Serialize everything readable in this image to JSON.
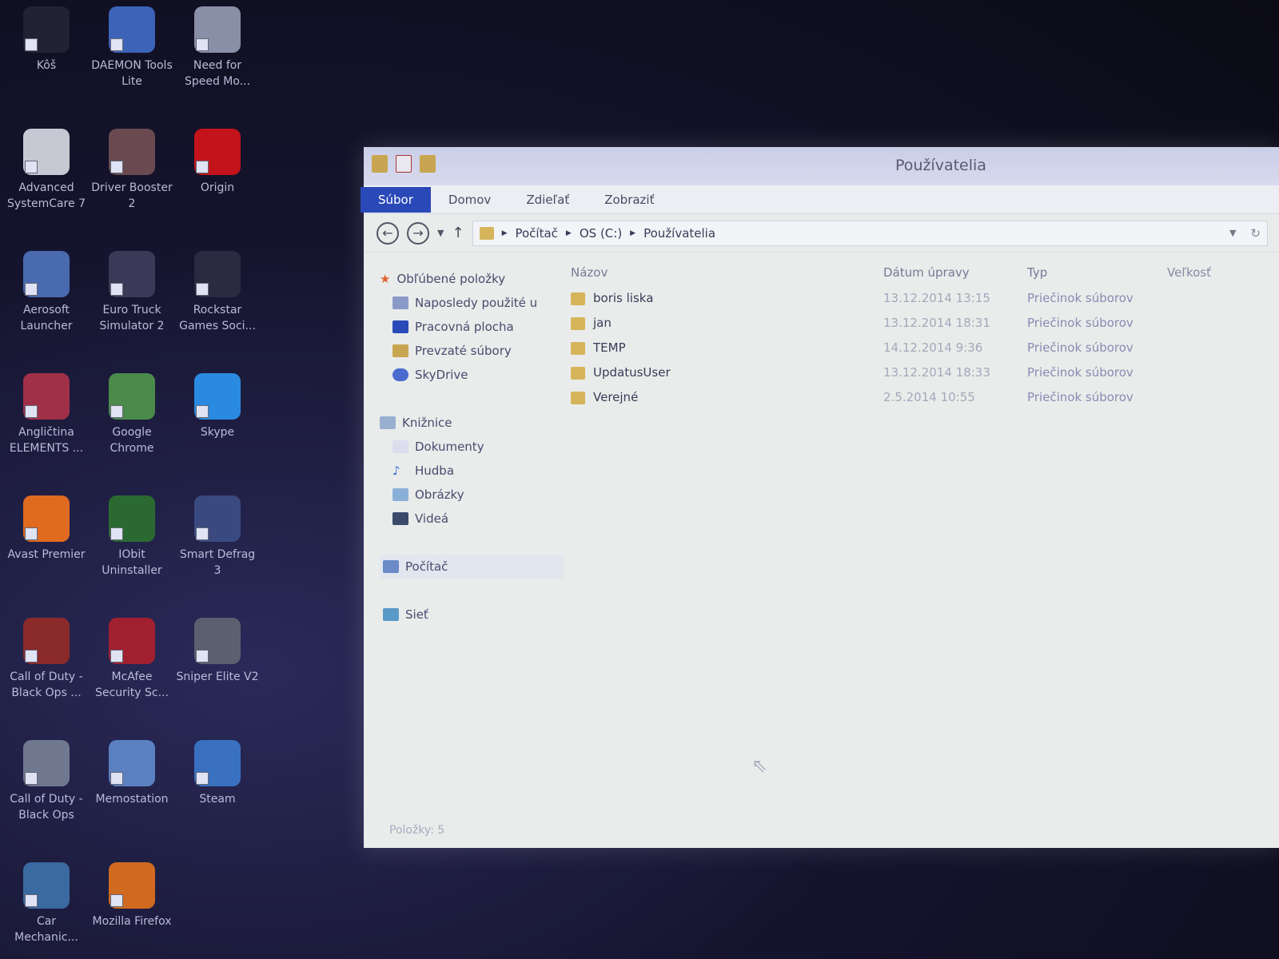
{
  "desktop": {
    "icons": [
      {
        "label": "Kôš",
        "color": "#223"
      },
      {
        "label": "DAEMON Tools Lite",
        "color": "#3c63b8"
      },
      {
        "label": "Need for Speed Mo...",
        "color": "#8a8fa8"
      },
      {
        "label": "Advanced SystemCare 7",
        "color": "#c8c8d4"
      },
      {
        "label": "Driver Booster 2",
        "color": "#6a4a50"
      },
      {
        "label": "Origin",
        "color": "#c2141a"
      },
      {
        "label": "Aerosoft Launcher",
        "color": "#4a6ab0"
      },
      {
        "label": "Euro Truck Simulator 2",
        "color": "#3a3a58"
      },
      {
        "label": "Rockstar Games Soci...",
        "color": "#2a2a40"
      },
      {
        "label": "Angličtina ELEMENTS ...",
        "color": "#a03048"
      },
      {
        "label": "Google Chrome",
        "color": "#4a8a4a"
      },
      {
        "label": "Skype",
        "color": "#2a8ae0"
      },
      {
        "label": "Avast Premier",
        "color": "#e06a20"
      },
      {
        "label": "IObit Uninstaller",
        "color": "#2a6a30"
      },
      {
        "label": "Smart Defrag 3",
        "color": "#3a4a80"
      },
      {
        "label": "Call of Duty - Black Ops ...",
        "color": "#8a2a2a"
      },
      {
        "label": "McAfee Security Sc...",
        "color": "#a02030"
      },
      {
        "label": "Sniper Elite V2",
        "color": "#5a6070"
      },
      {
        "label": "Call of Duty - Black Ops",
        "color": "#707890"
      },
      {
        "label": "Memostation",
        "color": "#5a80c0"
      },
      {
        "label": "Steam",
        "color": "#3a70c0"
      },
      {
        "label": "Car Mechanic...",
        "color": "#3a6aa0"
      },
      {
        "label": "Mozilla Firefox",
        "color": "#d06a20"
      }
    ]
  },
  "window": {
    "title": "Používatelia",
    "tabs": [
      "Súbor",
      "Domov",
      "Zdieľať",
      "Zobraziť"
    ],
    "path": [
      "Počítač",
      "OS (C:)",
      "Používatelia"
    ],
    "nav": {
      "favorites": {
        "label": "Obľúbené položky",
        "items": [
          "Naposledy použité u",
          "Pracovná plocha",
          "Prevzaté súbory",
          "SkyDrive"
        ]
      },
      "libraries": {
        "label": "Knižnice",
        "items": [
          "Dokumenty",
          "Hudba",
          "Obrázky",
          "Videá"
        ]
      },
      "computer": "Počítač",
      "network": "Sieť"
    },
    "columns": [
      "Názov",
      "Dátum úpravy",
      "Typ",
      "Veľkosť"
    ],
    "files": [
      {
        "name": "boris liska",
        "date": "13.12.2014 13:15",
        "type": "Priečinok súborov",
        "size": ""
      },
      {
        "name": "jan",
        "date": "13.12.2014 18:31",
        "type": "Priečinok súborov",
        "size": ""
      },
      {
        "name": "TEMP",
        "date": "14.12.2014 9:36",
        "type": "Priečinok súborov",
        "size": ""
      },
      {
        "name": "UpdatusUser",
        "date": "13.12.2014 18:33",
        "type": "Priečinok súborov",
        "size": ""
      },
      {
        "name": "Verejné",
        "date": "2.5.2014 10:55",
        "type": "Priečinok súborov",
        "size": ""
      }
    ],
    "status": "Položky: 5"
  }
}
